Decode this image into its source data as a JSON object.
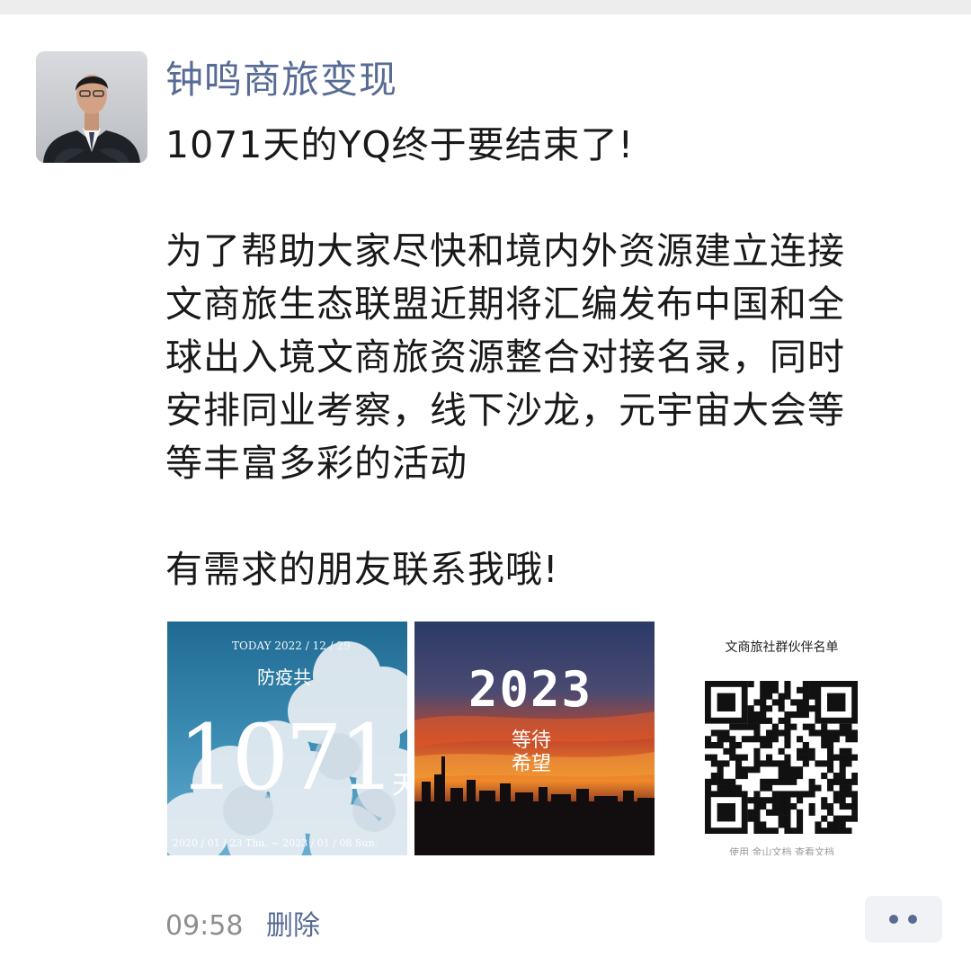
{
  "post": {
    "author": "钟鸣商旅变现",
    "lines": [
      "1071天的YQ终于要结束了!",
      "",
      "为了帮助大家尽快和境内外资源建立连接",
      "文商旅生态联盟近期将汇编发布中国和全",
      "球出入境文商旅资源整合对接名录，同时",
      "安排同业考察，线下沙龙，元宇宙大会等",
      "等丰富多彩的活动",
      "",
      "有需求的朋友联系我哦!"
    ],
    "time": "09:58",
    "delete_label": "删除"
  },
  "images": {
    "img1": {
      "top": "TODAY  2022 / 12 / 29",
      "caption": "防疫共",
      "number": "1071",
      "suffix": "天",
      "range": "2020 / 01 / 23 Thu. ~ 2023 / 01 / 08 Sun."
    },
    "img2": {
      "year": "2023",
      "line1": "等待",
      "line2": "希望"
    },
    "img3": {
      "title": "文商旅社群伙伴名单",
      "footer": "使用 金山文档 查看文档"
    }
  },
  "colors": {
    "link": "#576b95",
    "text": "#191919",
    "meta": "#8e8e8e",
    "more_bg": "#f1f2f5"
  },
  "icons": [
    "more-actions-icon"
  ]
}
